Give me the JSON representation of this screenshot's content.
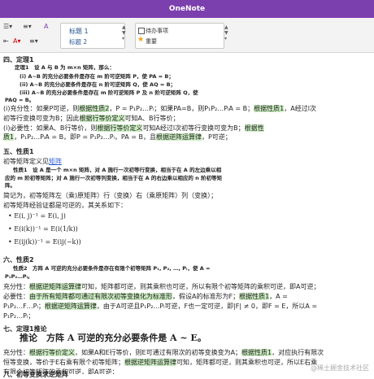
{
  "window": {
    "title": "OneNote"
  },
  "ribbon": {
    "styles": [
      "标题 1",
      "标题 2"
    ],
    "tags": [
      "待办事项",
      "重要"
    ]
  },
  "content": {
    "s4_title": "四、定理1",
    "s4_thm": "定理1　设 A 与 B 为 m×n 矩阵，那么：",
    "s4_i": "(i) A~B 的充分必要条件是存在 m 阶可逆矩阵 P，使 PA = B；",
    "s4_ii": "(ii) A~B 的充分必要条件是存在 n 阶可逆矩阵 Q，使 AQ = B；",
    "s4_iii": "(iii) A~B 的充分必要条件是存在 m 阶可逆矩阵 P 及 n 阶可逆矩阵 Q，使",
    "s4_iii2": "PAQ = B。",
    "s4_p1a": "(ⅰ)充分性：如果P可逆，则",
    "s4_p1b": "根据性质2",
    "s4_p1c": "，P = P₁P₂…Pₗ；如果PA=B，则P₁P₂…PₗA = B；",
    "s4_p1d": "根据性质1",
    "s4_p1e": "，A经过l次",
    "s4_p2a": "初等行变换可变为B；因此",
    "s4_p2b": "根据行等价定义",
    "s4_p2c": "可知A、B行等价；",
    "s4_p3a": "(ⅰ)必要性：如果A、B行等价，则",
    "s4_p3b": "根据行等价定义",
    "s4_p3c": "可知A经过l次初等行变换可变为B；",
    "s4_p3d": "根据性",
    "s4_p4a": "质1",
    "s4_p4b": "，P₁P₂…PₗA = B，即P = P₁P₂…Pₗ，PA = B，且",
    "s4_p4c": "根据逆阵运算律",
    "s4_p4d": "，P可逆；",
    "s5_title": "五、性质1",
    "s5_l1a": "初等矩阵定义见",
    "s5_l1b": "矩阵",
    "s5_l2": "性质1　设 A 是一个 m×n 矩阵，对 A 施行一次初等行变换，相当于在 A 的左边乘以相",
    "s5_l3": "应的 m 阶初等矩阵；对 A 施行一次初等列变换，相当于在 A 的右边乘以相应的 n 阶初等矩",
    "s5_l4": "阵。",
    "s5_l5": "简记为，初等矩阵左（乘)原矩阵）行（变换）右（乘原矩阵）列（变换）；",
    "s5_l6": "初等矩阵经验证都是可逆的，其关系如下：",
    "s5_f1": "E(i, j)⁻¹ = E(i, j)",
    "s5_f2": "E(i(k))⁻¹ = E(i(1/k))",
    "s5_f3": "E(ij(k))⁻¹ = E(ij(−k))",
    "s6_title": "六、性质2",
    "s6_l1": "性质2　方阵 A 可逆的充分必要条件是存在有限个初等矩阵 P₁, P₂, …, Pₗ，使 A =",
    "s6_l2": "P₁P₂…Pₗ。",
    "s6_l3a": "充分性：",
    "s6_l3b": "根据逆矩阵运算律",
    "s6_l3c": "可知，矩阵都可逆，则其乘积也可逆，所以有限个初等矩阵的乘积可逆，即A可逆；",
    "s6_l4a": "必要性：",
    "s6_l4b": "由于所有矩阵都可通过有限次初等变换化为标准形",
    "s6_l4c": "，假设A的标准形为F；",
    "s6_l4d": "根据性质1",
    "s6_l4e": "，A =",
    "s6_l5a": "P₁P₂…F…Pₗ；",
    "s6_l5b": "根据逆矩阵运算律",
    "s6_l5c": "，由于A可逆且P₁P₂…Pₗ可逆，F也一定可逆，即|F| ≠ 0，即F = E，所以A =",
    "s6_l6": "P₁P₂…Pₗ；",
    "s7_title": "七、定理1推论",
    "s7_big": "推论　方阵 A 可逆的充分必要条件是 A ~ E。",
    "s7_l1a": "充分性：",
    "s7_l1b": "根据行等价定义",
    "s7_l1c": "，如果A和E行等价，则E可通过有限次的初等变换变为A；",
    "s7_l1d": "根据性质1",
    "s7_l1e": "，对应执行有限次",
    "s7_l2a": "恒等变换，等价于E右乘有限个初等矩阵；",
    "s7_l2b": "根据逆矩阵运算律",
    "s7_l2c": "可知，矩阵都可逆，则其乘积也可逆，所以E右乘",
    "s7_l3": "有限个初等矩阵的乘积可逆，即A可逆；",
    "s8_title": "八、初等变换求逆矩阵",
    "watermark": "@稀土掘金技术社区"
  }
}
